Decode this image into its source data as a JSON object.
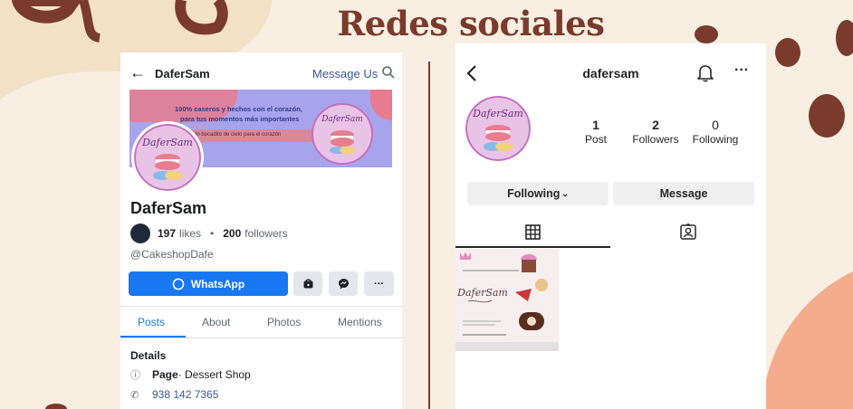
{
  "page": {
    "title": "Redes sociales"
  },
  "colors": {
    "accent": "#7a3b2c",
    "background": "#f8efe2",
    "fb_blue": "#1877f2",
    "blob_light": "#f2e1c5",
    "blob_peach": "#f3ad8d"
  },
  "facebook": {
    "header": {
      "back_icon": "arrow-left-icon",
      "name": "DaferSam",
      "message_us": "Message Us",
      "search_icon": "search-icon"
    },
    "cover": {
      "line1": "100% caseros y hechos con el corazón,",
      "line2": "para tus momentos más importantes",
      "banner": "Un bocadito de cielo para el corazón",
      "logo_text": "DaferSam"
    },
    "avatar_text": "DaferSam",
    "page_name": "DaferSam",
    "likes_count": "197",
    "likes_label": "likes",
    "bullet": "•",
    "followers_count": "200",
    "followers_label": "followers",
    "handle": "@CakeshopDafe",
    "buttons": {
      "whatsapp": "WhatsApp",
      "whatsapp_icon": "whatsapp-icon",
      "shop_icon": "shop-bag-icon",
      "messenger_icon": "messenger-icon",
      "more_label": "···"
    },
    "tabs": [
      "Posts",
      "About",
      "Photos",
      "Mentions"
    ],
    "details_title": "Details",
    "page_label": "Page",
    "page_category": " · Dessert Shop",
    "phone": "938 142 7365"
  },
  "instagram": {
    "back_icon": "chevron-left-icon",
    "username": "dafersam",
    "bell_icon": "bell-icon",
    "more_icon": "···",
    "avatar_text": "DaferSam",
    "stats": [
      {
        "value": "1",
        "label": "Post"
      },
      {
        "value": "2",
        "label": "Followers"
      },
      {
        "value": "0",
        "label": "Following"
      }
    ],
    "following_button": "Following",
    "message_button": "Message",
    "tab_icons": [
      "grid-icon",
      "tagged-icon"
    ],
    "post_text": "DaferSam"
  }
}
